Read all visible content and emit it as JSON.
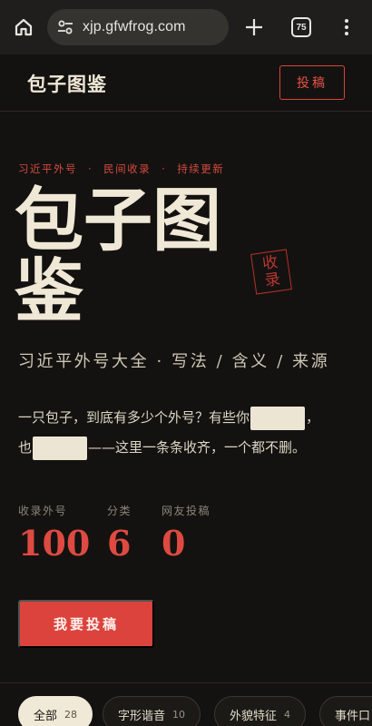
{
  "browser": {
    "url": "xjp.gfwfrog.com",
    "tab_count": "75"
  },
  "header": {
    "logo": "包子图鉴",
    "submit_label": "投稿"
  },
  "hero": {
    "kicker": [
      "习近平外号",
      "民间收录",
      "持续更新"
    ],
    "kicker_sep": "·",
    "title_line1": "包子图",
    "title_line2": "鉴",
    "seal_line1": "收",
    "seal_line2": "录",
    "subtitle": "习近平外号大全 · 写法 / 含义 / 来源",
    "desc_part1": "一只包子，到底有多少个外号？有些你",
    "desc_part2": "，",
    "desc_part3": "也",
    "desc_part4": "——这里一条条收齐，一个都不删。"
  },
  "stats": [
    {
      "label": "收录外号",
      "value": "100"
    },
    {
      "label": "分类",
      "value": "6"
    },
    {
      "label": "网友投稿",
      "value": "0"
    }
  ],
  "cta_label": "我要投稿",
  "filters": [
    {
      "label": "全部",
      "count": "28",
      "active": true
    },
    {
      "label": "字形谐音",
      "count": "10",
      "active": false
    },
    {
      "label": "外貌特征",
      "count": "4",
      "active": false
    },
    {
      "label": "事件口",
      "count": "",
      "active": false
    }
  ],
  "colors": {
    "background": "#141210",
    "accent": "#dc433d",
    "text": "#f0e8d6"
  }
}
